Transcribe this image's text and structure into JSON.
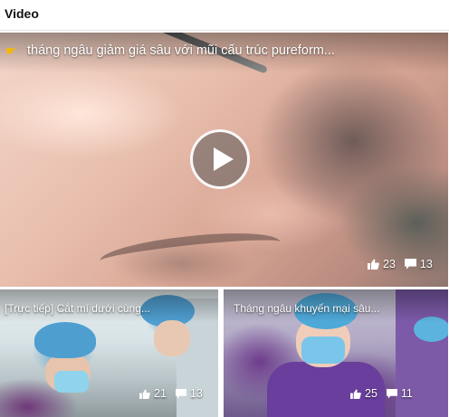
{
  "widget": {
    "title": "Video"
  },
  "main_video": {
    "title": "tháng ngâu giảm giá sâu với mũi cấu trúc pureform...",
    "title_icon": "pointing-hand-icon",
    "likes": "23",
    "comments": "13"
  },
  "sub_videos": [
    {
      "title": "[Trực tiếp] Cắt mí dưới cùng...",
      "likes": "21",
      "comments": "13"
    },
    {
      "title": "Tháng ngâu khuyến mại sâu...",
      "likes": "25",
      "comments": "11"
    }
  ],
  "colors": {
    "title_icon": "#f5b900",
    "overlay_text": "#ffffff",
    "header_text": "#111111"
  }
}
